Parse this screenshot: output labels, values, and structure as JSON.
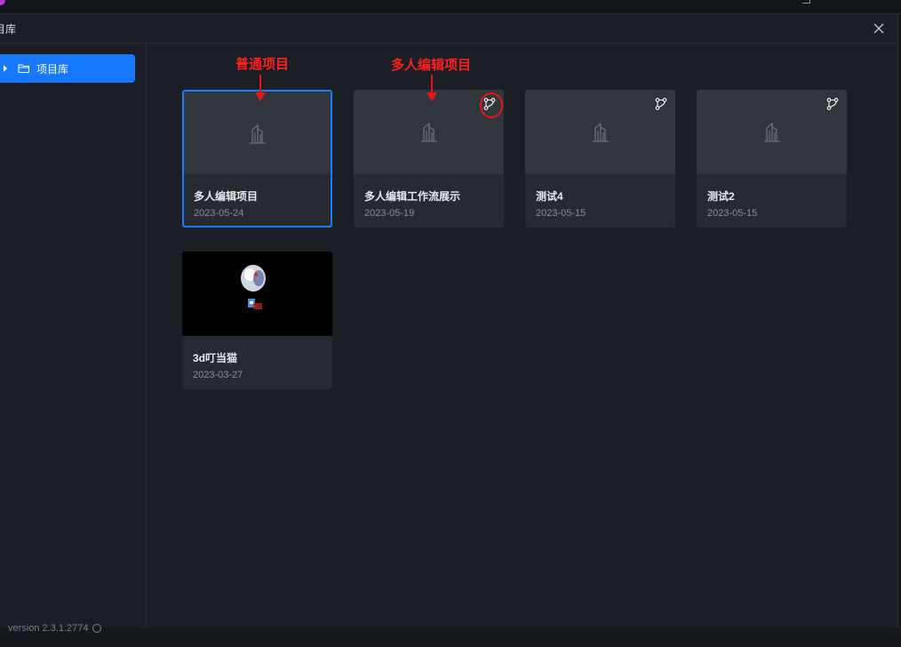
{
  "dialog": {
    "title": "目库",
    "close_icon": "close-icon"
  },
  "sidebar": {
    "items": [
      {
        "label": "项目库",
        "icon": "folder-icon",
        "active": true
      }
    ]
  },
  "projects": [
    {
      "name": "多人编辑项目",
      "date": "2023-05-24",
      "selected": true,
      "collaborative": false,
      "thumbnail": "placeholder-building-icon"
    },
    {
      "name": "多人编辑工作流展示",
      "date": "2023-05-19",
      "selected": false,
      "collaborative": true,
      "thumbnail": "placeholder-building-icon"
    },
    {
      "name": "测试4",
      "date": "2023-05-15",
      "selected": false,
      "collaborative": true,
      "thumbnail": "placeholder-building-icon"
    },
    {
      "name": "测试2",
      "date": "2023-05-15",
      "selected": false,
      "collaborative": true,
      "thumbnail": "placeholder-building-icon"
    },
    {
      "name": "3d叮当猫",
      "date": "2023-03-27",
      "selected": false,
      "collaborative": false,
      "thumbnail": "3d-render-image"
    }
  ],
  "annotations": {
    "normal_project": "普通项目",
    "multi_edit_project": "多人编辑项目",
    "color": "#ff1e1e"
  },
  "footer": {
    "version": "version 2.3.1.2774"
  },
  "colors": {
    "accent": "#1677ff",
    "selected_border": "#1d7cf2",
    "background": "#1b1e24",
    "card": "#262a31"
  }
}
